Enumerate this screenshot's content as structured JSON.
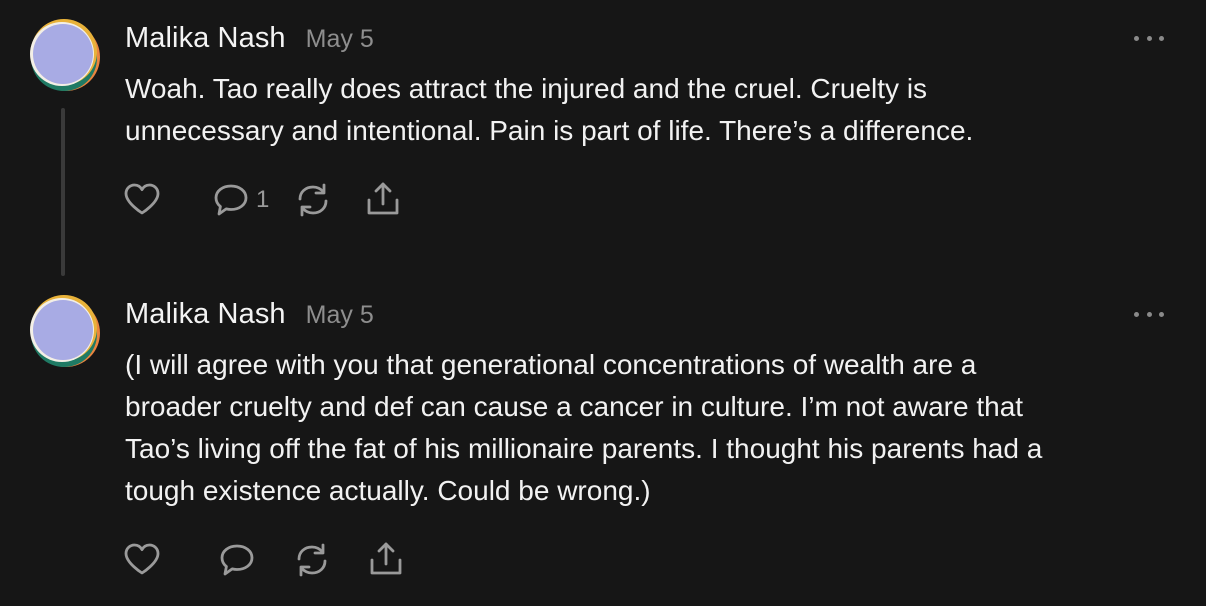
{
  "posts": [
    {
      "author": "Malika Nash",
      "date": "May 5",
      "text": "Woah. Tao really does attract the injured and the cruel. Cruelty is\nunnecessary and intentional. Pain is part of life. There’s a difference.",
      "reply_count": "1",
      "icons": [
        "heart-icon",
        "comment-icon",
        "repost-icon",
        "share-icon",
        "more-icon"
      ]
    },
    {
      "author": "Malika Nash",
      "date": "May 5",
      "text": "(I will agree with you that generational concentrations of wealth are a\nbroader cruelty and def can cause a cancer in culture. I’m not aware that\nTao’s living off the fat of his millionaire parents. I thought his parents had a\ntough existence actually. Could be wrong.)",
      "icons": [
        "heart-icon",
        "comment-icon",
        "repost-icon",
        "share-icon",
        "more-icon"
      ]
    }
  ],
  "colors": {
    "background": "#161616",
    "text": "#f2f2f2",
    "muted": "#8e8e8e",
    "avatar_fill": "#a8abe4",
    "avatar_orange": "#e9853f",
    "avatar_green": "#1f7a64",
    "avatar_yellow": "#e8b23a"
  }
}
